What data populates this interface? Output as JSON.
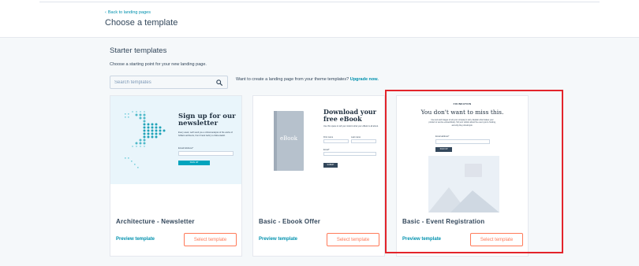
{
  "header": {
    "back_label": "Back to landing pages",
    "title": "Choose a template"
  },
  "section": {
    "title": "Starter templates",
    "subtitle": "Choose a starting point for your new landing page."
  },
  "search": {
    "placeholder": "Search templates",
    "value": ""
  },
  "upgrade": {
    "text": "Want to create a landing page from your theme templates?",
    "link": "Upgrade now."
  },
  "cards": [
    {
      "name": "Architecture - Newsletter",
      "preview_label": "Preview template",
      "select_label": "Select template",
      "thumb": {
        "title": "Sign up for our newsletter",
        "body": "Every week, we'll send you a critical analysis of the works of brilliant architects, from Frank Gehry to Zaha Hadid.",
        "field_label": "Email Address*",
        "button": "SIGN UP"
      }
    },
    {
      "name": "Basic - Ebook Offer",
      "preview_label": "Preview template",
      "select_label": "Select template",
      "thumb": {
        "cover": "eBook",
        "title": "Download your free eBook",
        "body": "Use this space to tell your visitors what your eBook is all about.",
        "first_name": "First name",
        "last_name": "Last name",
        "email": "Email*",
        "button": "SUBMIT"
      }
    },
    {
      "name": "Basic - Event Registration",
      "preview_label": "Preview template",
      "select_label": "Select template",
      "selected": true,
      "thumb": {
        "brand": "FOUNDATION",
        "title": "You don't want to miss this.",
        "body": "Use text and images to tell your company's story. Explain what makes your product or service extraordinary. Tell your visitors about the event you're hosting, and why they should join.",
        "field_label": "Email address*",
        "button": "SIGN UP"
      }
    }
  ],
  "colors": {
    "link": "#0091ae",
    "accent": "#ff7a59",
    "highlight": "#e3242b",
    "text": "#33475b"
  }
}
